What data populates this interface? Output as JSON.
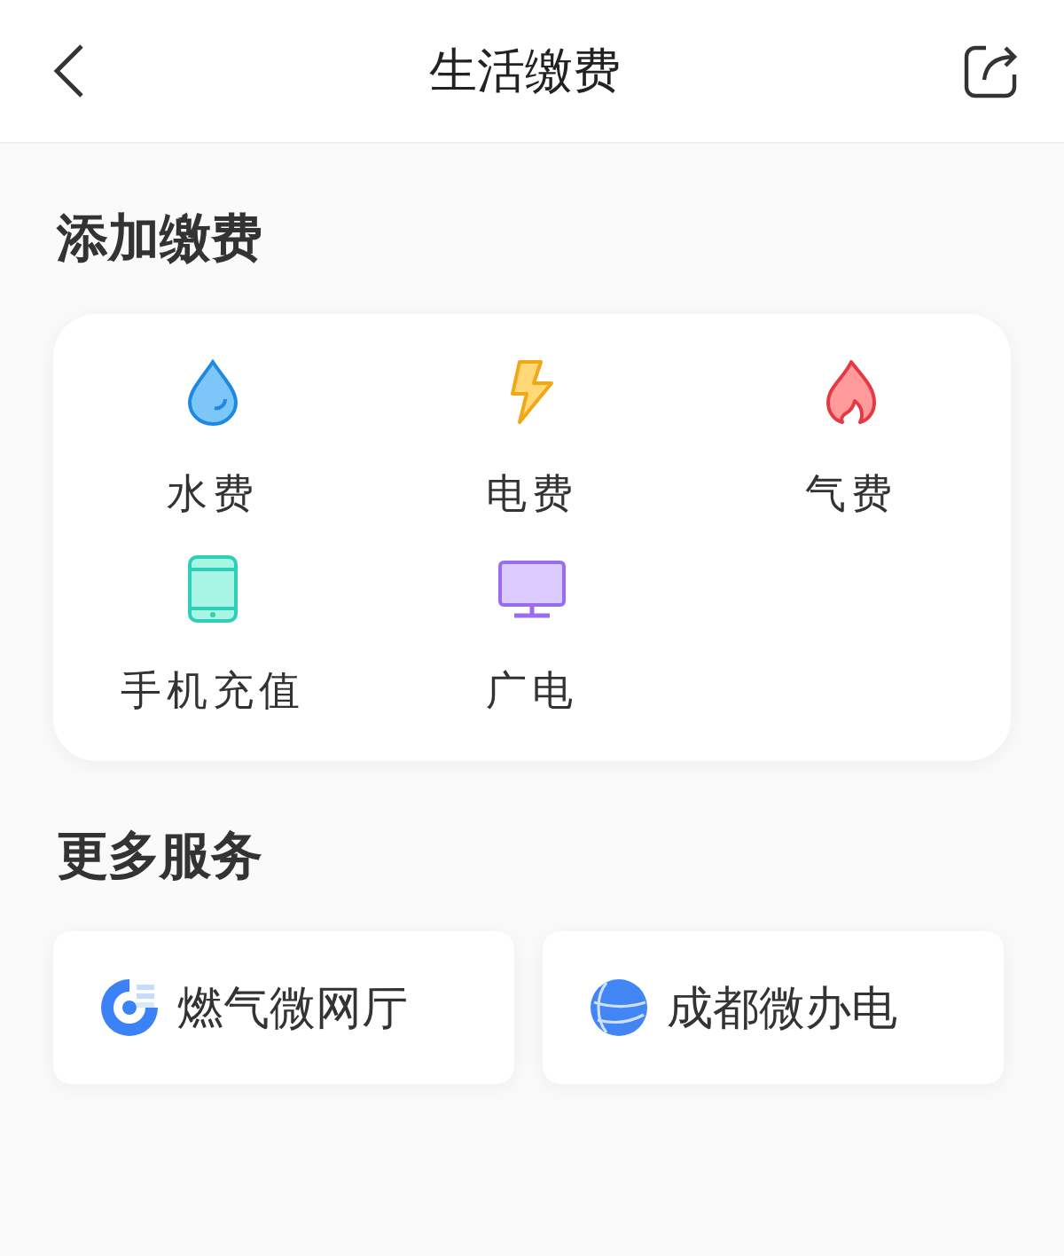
{
  "header": {
    "title": "生活缴费"
  },
  "add_payment": {
    "title": "添加缴费",
    "items": [
      {
        "label": "水费",
        "kind": "water"
      },
      {
        "label": "电费",
        "kind": "electric"
      },
      {
        "label": "气费",
        "kind": "gas"
      },
      {
        "label": "手机充值",
        "kind": "phone"
      },
      {
        "label": "广电",
        "kind": "tv"
      }
    ]
  },
  "more_services": {
    "title": "更多服务",
    "items": [
      {
        "label": "燃气微网厅",
        "kind": "gas-logo"
      },
      {
        "label": "成都微办电",
        "kind": "globe-logo"
      }
    ]
  }
}
